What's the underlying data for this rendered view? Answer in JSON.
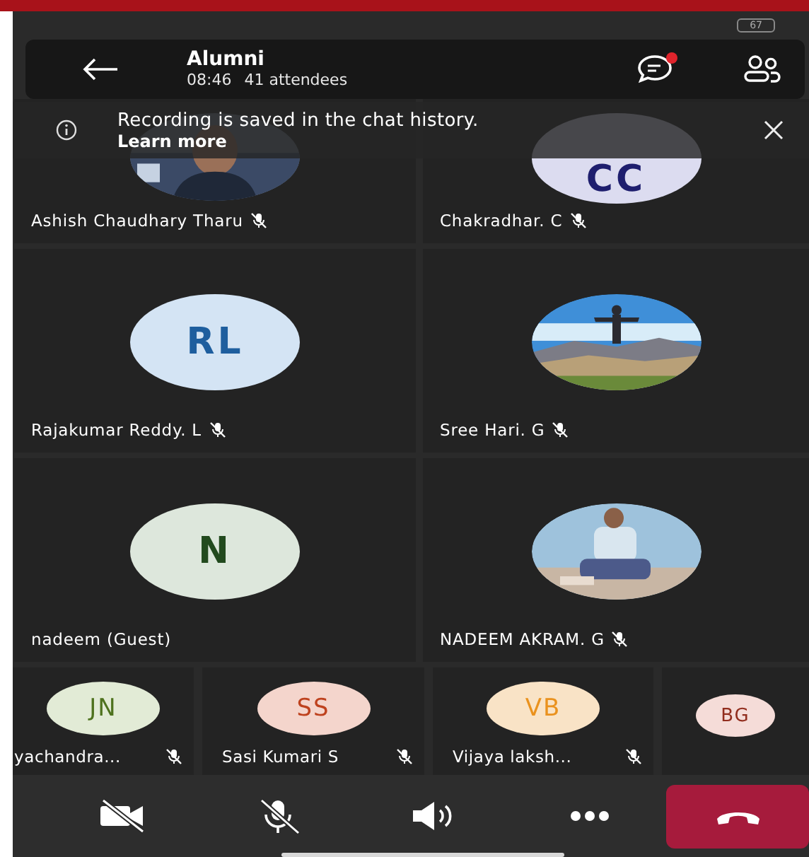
{
  "status_bar": {
    "battery": "67"
  },
  "header": {
    "title": "Alumni",
    "duration": "08:46",
    "attendees": "41 attendees",
    "chat_unread": true
  },
  "banner": {
    "message": "Recording is saved in the chat history.",
    "link": "Learn more"
  },
  "participants": [
    {
      "name": "Ashish Chaudhary Tharu",
      "muted": true
    },
    {
      "name": "Chakradhar. C",
      "muted": true,
      "avatar": {
        "kind": "initials",
        "initials": "CC",
        "color": "#dcdcf0"
      }
    },
    {
      "name": "Rajakumar Reddy. L",
      "muted": true,
      "avatar": {
        "kind": "initials",
        "initials": "RL",
        "color": "#d4e4f4"
      }
    },
    {
      "name": "Sree Hari. G",
      "muted": true
    },
    {
      "name": "nadeem (Guest)",
      "muted": false,
      "avatar": {
        "kind": "initials",
        "initials": "N",
        "color": "#dde7dc"
      }
    },
    {
      "name": "NADEEM AKRAM. G",
      "muted": true
    }
  ],
  "gallery_strip": [
    {
      "name": "yachandra...",
      "muted": true,
      "initials": "JN",
      "color": "#e2ebd6"
    },
    {
      "name": "Sasi Kumari S",
      "muted": true,
      "initials": "SS",
      "color": "#f4d5cc"
    },
    {
      "name": "Vijaya laksh...",
      "muted": true,
      "initials": "VB",
      "color": "#f9e3c6"
    },
    {
      "muted": false,
      "initials": "BG",
      "color": "#f5dcd8"
    }
  ],
  "controls": [
    {
      "kind": "camera",
      "off": true
    },
    {
      "kind": "mic",
      "off": true
    },
    {
      "kind": "speaker"
    },
    {
      "kind": "more"
    },
    {
      "kind": "end_call"
    }
  ]
}
